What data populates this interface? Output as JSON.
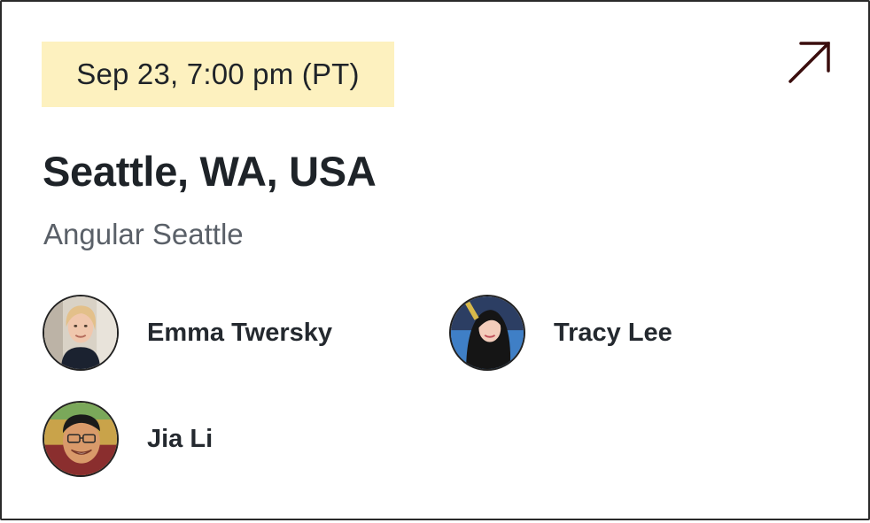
{
  "event": {
    "datetime": "Sep 23, 7:00 pm (PT)",
    "location": "Seattle, WA, USA",
    "group": "Angular Seattle",
    "open_icon": "arrow-up-right-icon"
  },
  "colors": {
    "badge_bg": "#fdf1bf",
    "arrow": "#3a0d0d",
    "title": "#1e2328",
    "subtitle": "#5a6068"
  },
  "speakers": [
    {
      "name": "Emma Twersky",
      "avatar": "avatar-emma-twersky"
    },
    {
      "name": "Tracy Lee",
      "avatar": "avatar-tracy-lee"
    },
    {
      "name": "Jia Li",
      "avatar": "avatar-jia-li"
    }
  ]
}
